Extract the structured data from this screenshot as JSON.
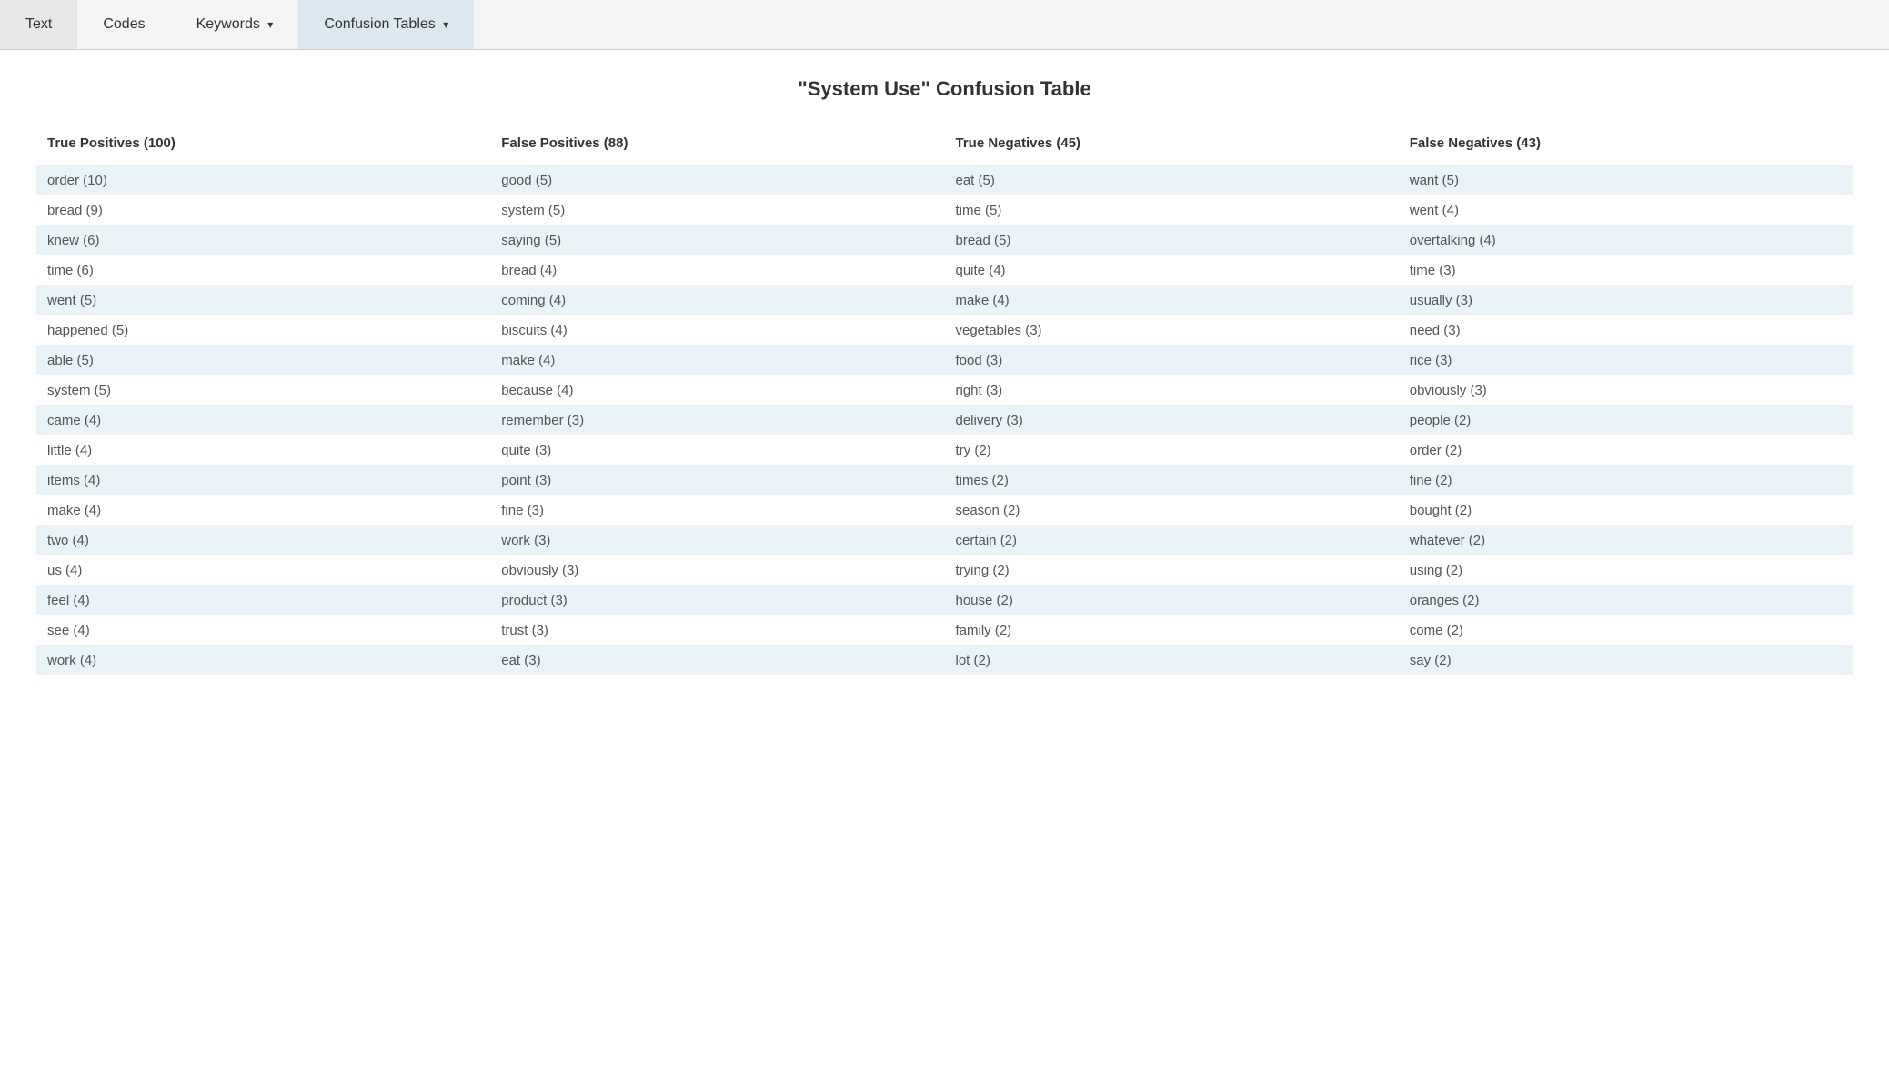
{
  "nav": {
    "items": [
      {
        "label": "Text",
        "id": "text",
        "active": false,
        "dropdown": false
      },
      {
        "label": "Codes",
        "id": "codes",
        "active": false,
        "dropdown": false
      },
      {
        "label": "Keywords",
        "id": "keywords",
        "active": false,
        "dropdown": true
      },
      {
        "label": "Confusion Tables",
        "id": "confusion-tables",
        "active": true,
        "dropdown": true
      }
    ]
  },
  "page": {
    "title": "\"System Use\" Confusion Table"
  },
  "columns": {
    "tp_header": "True Positives (100)",
    "fp_header": "False Positives (88)",
    "tn_header": "True Negatives (45)",
    "fn_header": "False Negatives (43)"
  },
  "rows": [
    {
      "tp": "order (10)",
      "fp": "good (5)",
      "tn": "eat (5)",
      "fn": "want (5)"
    },
    {
      "tp": "bread (9)",
      "fp": "system (5)",
      "tn": "time (5)",
      "fn": "went (4)"
    },
    {
      "tp": "knew (6)",
      "fp": "saying (5)",
      "tn": "bread (5)",
      "fn": "overtalking (4)"
    },
    {
      "tp": "time (6)",
      "fp": "bread (4)",
      "tn": "quite (4)",
      "fn": "time (3)"
    },
    {
      "tp": "went (5)",
      "fp": "coming (4)",
      "tn": "make (4)",
      "fn": "usually (3)"
    },
    {
      "tp": "happened (5)",
      "fp": "biscuits (4)",
      "tn": "vegetables (3)",
      "fn": "need (3)"
    },
    {
      "tp": "able (5)",
      "fp": "make (4)",
      "tn": "food (3)",
      "fn": "rice (3)"
    },
    {
      "tp": "system (5)",
      "fp": "because (4)",
      "tn": "right (3)",
      "fn": "obviously (3)"
    },
    {
      "tp": "came (4)",
      "fp": "remember (3)",
      "tn": "delivery (3)",
      "fn": "people (2)"
    },
    {
      "tp": "little (4)",
      "fp": "quite (3)",
      "tn": "try (2)",
      "fn": "order (2)"
    },
    {
      "tp": "items (4)",
      "fp": "point (3)",
      "tn": "times (2)",
      "fn": "fine (2)"
    },
    {
      "tp": "make (4)",
      "fp": "fine (3)",
      "tn": "season (2)",
      "fn": "bought (2)"
    },
    {
      "tp": "two (4)",
      "fp": "work (3)",
      "tn": "certain (2)",
      "fn": "whatever (2)"
    },
    {
      "tp": "us (4)",
      "fp": "obviously (3)",
      "tn": "trying (2)",
      "fn": "using (2)"
    },
    {
      "tp": "feel (4)",
      "fp": "product (3)",
      "tn": "house (2)",
      "fn": "oranges (2)"
    },
    {
      "tp": "see (4)",
      "fp": "trust (3)",
      "tn": "family (2)",
      "fn": "come (2)"
    },
    {
      "tp": "work (4)",
      "fp": "eat (3)",
      "tn": "lot (2)",
      "fn": "say (2)"
    }
  ]
}
